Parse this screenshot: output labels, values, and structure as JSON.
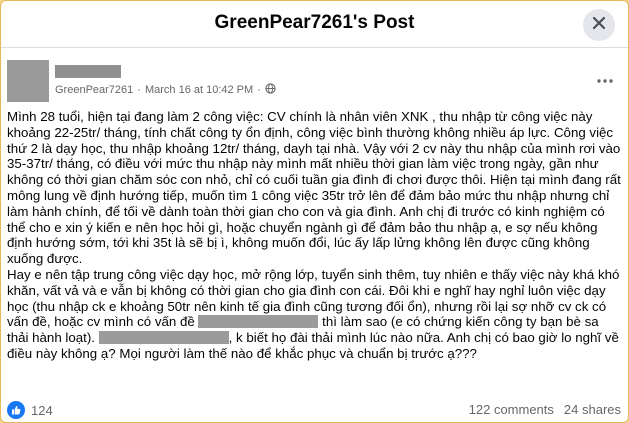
{
  "header": {
    "title": "GreenPear7261's Post"
  },
  "post": {
    "author": "GreenPear7261",
    "date": "March 16 at 10:42 PM",
    "separator": "·",
    "paragraph1": "Mình 28 tuổi, hiện tại đang làm 2 công việc: CV chính là nhân viên XNK , thu nhập từ công việc này khoảng 22-25tr/ tháng, tính chất công ty ổn định, công việc bình thường không nhiều áp lực. Công việc thứ 2 là dạy học, thu nhập khoảng 12tr/ tháng, dayh tại nhà. Vậy với 2 cv này thu nhập của mình rơi vào 35-37tr/ tháng, có điều với mức thu nhập này mình mất nhiều thời gian làm việc trong ngày, gần như không có thời gian chăm sóc con nhỏ, chỉ có cuối tuần gia đình đi chơi được thôi. Hiện tại mình đang rất mông lung về định hướng tiếp, muốn tìm 1 công việc 35tr trở lên để đảm bảo mức thu nhập nhưng chỉ làm hành chính, để tối về dành toàn thời gian cho con và gia đình. Anh chị đi trước có kinh nghiệm có thể cho e xin ý kiến e nên học hỏi gì, hoặc chuyển ngành gì để đảm bảo thu nhập ạ, e sợ nếu không định hướng sớm, tới khi 35t là sẽ bị ì, không muốn đổi, lúc ấy lấp lửng không lên được cũng không xuống được.",
    "paragraph2_a": "Hay e nên tập trung công việc dạy học, mở rộng lớp, tuyển sinh thêm, tuy nhiên e thấy việc này khá khó khăn, vất vả và e vẫn bị không có thời gian cho gia đình con cái. Đôi khi e nghĩ hay nghỉ luôn việc dạy học (thu nhập ck e khoảng 50tr nên kinh tế gia đình cũng tương đối ổn), nhưng rồi lại sợ nhỡ cv ck có vấn đề, hoặc cv mình có vấn đề",
    "paragraph2_b": "thì làm sao (e có chứng kiến công ty bạn bè sa thải hành loạt).",
    "paragraph2_c": ", k biết họ đài thải mình lúc nào nữa. Anh chị có bao giờ lo nghĩ về điều này không ạ? Mọi người làm thế nào để khắc phục và chuẩn bị trước ạ???"
  },
  "footer": {
    "reaction_count": "124",
    "comments": "122 comments",
    "shares": "24 shares"
  }
}
